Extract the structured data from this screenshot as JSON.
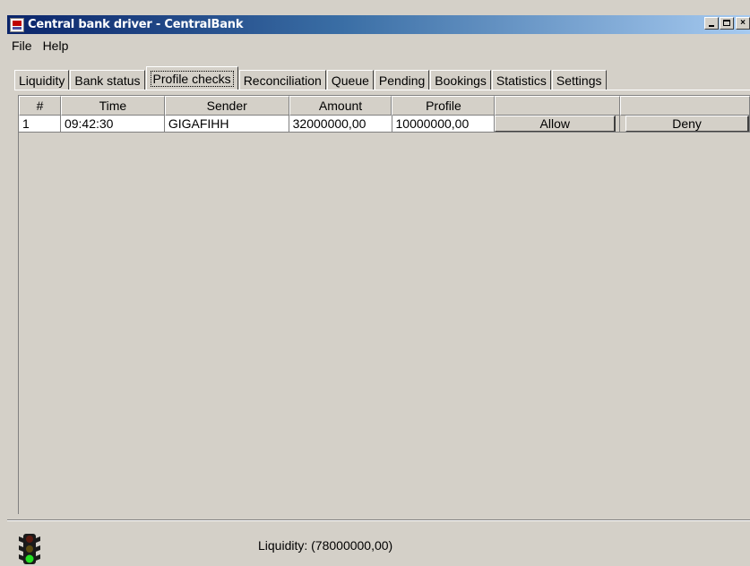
{
  "window": {
    "title": "Central bank driver - CentralBank"
  },
  "menu": {
    "items": [
      "File",
      "Help"
    ]
  },
  "tabs": [
    {
      "label": "Liquidity",
      "active": false
    },
    {
      "label": "Bank status",
      "active": false
    },
    {
      "label": "Profile checks",
      "active": true
    },
    {
      "label": "Reconciliation",
      "active": false
    },
    {
      "label": "Queue",
      "active": false
    },
    {
      "label": "Pending",
      "active": false
    },
    {
      "label": "Bookings",
      "active": false
    },
    {
      "label": "Statistics",
      "active": false
    },
    {
      "label": "Settings",
      "active": false
    }
  ],
  "table": {
    "columns": [
      "#",
      "Time",
      "Sender",
      "Amount",
      "Profile",
      "",
      ""
    ],
    "rows": [
      {
        "num": "1",
        "time": "09:42:30",
        "sender": "GIGAFIHH",
        "amount": "32000000,00",
        "profile": "10000000,00",
        "allow_label": "Allow",
        "deny_label": "Deny"
      }
    ]
  },
  "status": {
    "liquidity_text": "Liquidity: (78000000,00)",
    "traffic_light_icon": "traffic-light-icon",
    "traffic_light_state": "green"
  },
  "colors": {
    "titlebar_start": "#0a246a",
    "titlebar_end": "#a6caf0",
    "face": "#d4d0c8"
  }
}
